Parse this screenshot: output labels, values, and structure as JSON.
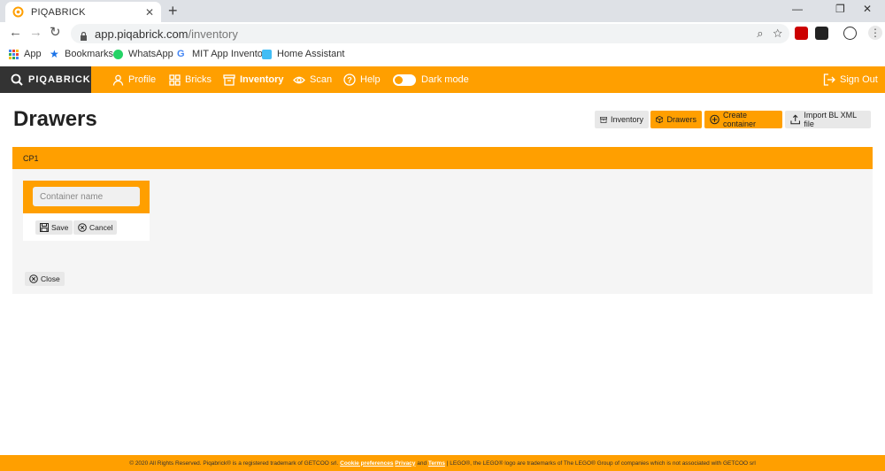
{
  "browser": {
    "tab_title": "PIQABRICK",
    "url_host": "app.piqabrick.com",
    "url_path": "/inventory",
    "bookmarks": [
      "App",
      "Bookmarks",
      "WhatsApp",
      "MIT App Inventor",
      "Home Assistant"
    ]
  },
  "nav": {
    "brand": "PIQABRICK",
    "items": [
      "Profile",
      "Bricks",
      "Inventory",
      "Scan",
      "Help"
    ],
    "dark_mode": "Dark mode",
    "sign_out": "Sign Out"
  },
  "page": {
    "title": "Drawers",
    "toolbar": {
      "inventory": "Inventory",
      "drawers": "Drawers",
      "create": "Create container",
      "import": "Import BL XML file"
    },
    "panel": {
      "header": "CP1",
      "input_placeholder": "Container name",
      "save": "Save",
      "cancel": "Cancel",
      "close": "Close"
    }
  },
  "footer": {
    "prefix": "© 2020 All Rights Reserved. Piqabrick® is a registered trademark of GETCOO srl.",
    "cookie": "Cookie preferences",
    "privacy": "Privacy",
    "and": "and",
    "terms": "Terms",
    "suffix": "| LEGO®, the LEGO® logo are trademarks of The LEGO® Group of companies which is not associated with GETCOO srl"
  },
  "colors": {
    "accent": "#ff9f00",
    "dark": "#333333"
  }
}
